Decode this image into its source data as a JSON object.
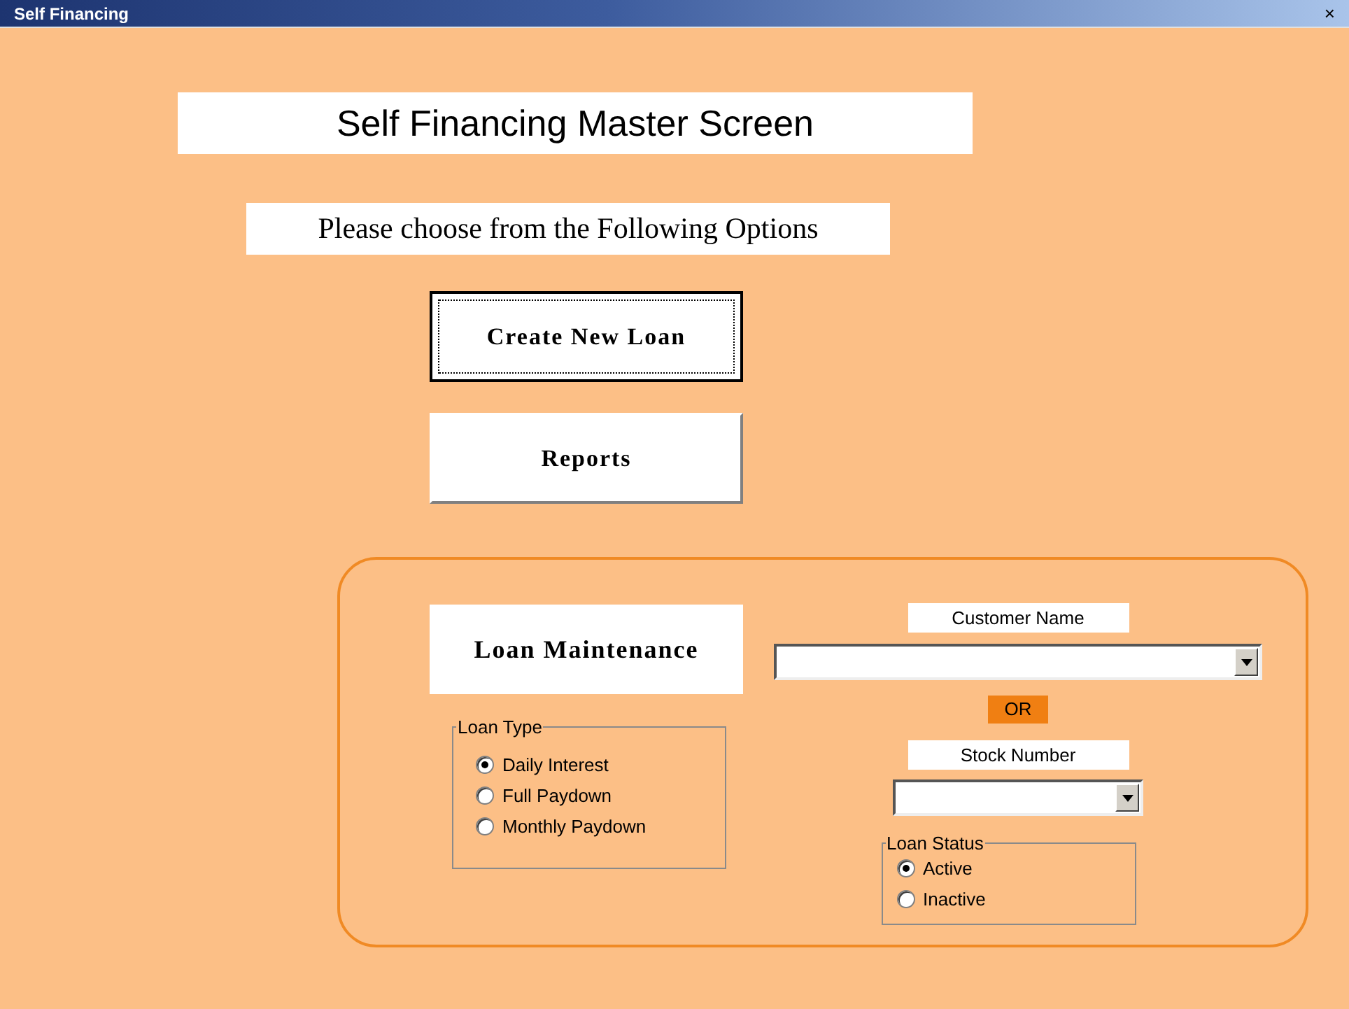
{
  "window": {
    "title": "Self Financing",
    "close": "×"
  },
  "header": {
    "title": "Self Financing Master Screen",
    "subtitle": "Please choose from the Following Options"
  },
  "buttons": [
    {
      "label": "Create New Loan",
      "focused": true
    },
    {
      "label": "Reports",
      "focused": false
    }
  ],
  "maintenance": {
    "title": "Loan Maintenance",
    "loan_type": {
      "label": "Loan Type",
      "options": [
        {
          "label": "Daily Interest",
          "selected": true
        },
        {
          "label": "Full Paydown",
          "selected": false
        },
        {
          "label": "Monthly Paydown",
          "selected": false
        }
      ]
    },
    "customer_name": {
      "label": "Customer Name"
    },
    "or": "OR",
    "stock_number": {
      "label": "Stock Number"
    },
    "loan_status": {
      "label": "Loan Status",
      "options": [
        {
          "label": "Active",
          "selected": true
        },
        {
          "label": "Inactive",
          "selected": false
        }
      ]
    }
  }
}
